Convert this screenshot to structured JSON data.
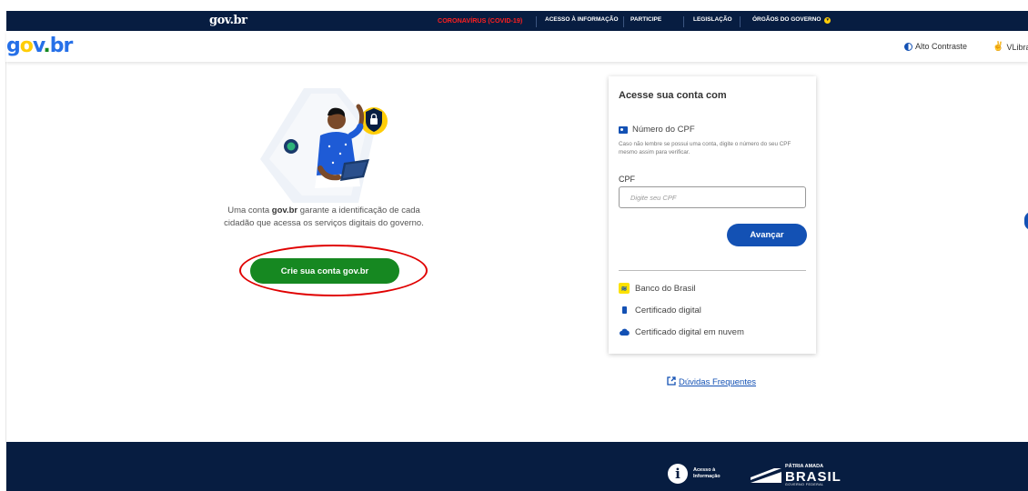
{
  "gov_bar": {
    "brand": "gov.br",
    "links": [
      {
        "label": "CORONAVÍRUS (COVID-19)"
      },
      {
        "label": "ACESSO À INFORMAÇÃO"
      },
      {
        "label": "PARTICIPE"
      },
      {
        "label": "LEGISLAÇÃO"
      },
      {
        "label": "ÓRGÃOS DO GOVERNO"
      }
    ]
  },
  "header": {
    "logo_g": "g",
    "logo_o": "o",
    "logo_v": "v",
    "logo_dot": ".",
    "logo_br": "br",
    "contrast_label": "Alto Contraste",
    "vlibras_label": "VLibras"
  },
  "intro": {
    "text_before": "Uma conta ",
    "bold": "gov.br",
    "text_after": " garante a identificação de cada cidadão que acessa os serviços digitais do governo."
  },
  "create_button": "Crie sua conta gov.br",
  "login": {
    "title": "Acesse sua conta com",
    "cpf_option": "Número do CPF",
    "hint": "Caso não lembre se possui uma conta, digite o número do seu CPF mesmo assim para verificar.",
    "cpf_label": "CPF",
    "cpf_placeholder": "Digite seu CPF",
    "cpf_value": "",
    "next_button": "Avançar",
    "alternatives": [
      {
        "label": "Banco do Brasil",
        "icon": "banco-do-brasil-icon"
      },
      {
        "label": "Certificado digital",
        "icon": "usb-token-icon"
      },
      {
        "label": "Certificado digital em nuvem",
        "icon": "cloud-icon"
      }
    ]
  },
  "faq_link": "Dúvidas Frequentes",
  "footer": {
    "acesso_line1": "Acesso à",
    "acesso_line2": "Informação",
    "patria_small": "PÁTRIA AMADA",
    "patria_big": "BRASIL",
    "patria_tiny": "GOVERNO FEDERAL"
  },
  "colors": {
    "gov_bar_bg": "#071d41",
    "primary_blue": "#1351b4",
    "create_green": "#168821",
    "covid_red": "#ff1f1f",
    "annotation_red": "#e00000"
  }
}
